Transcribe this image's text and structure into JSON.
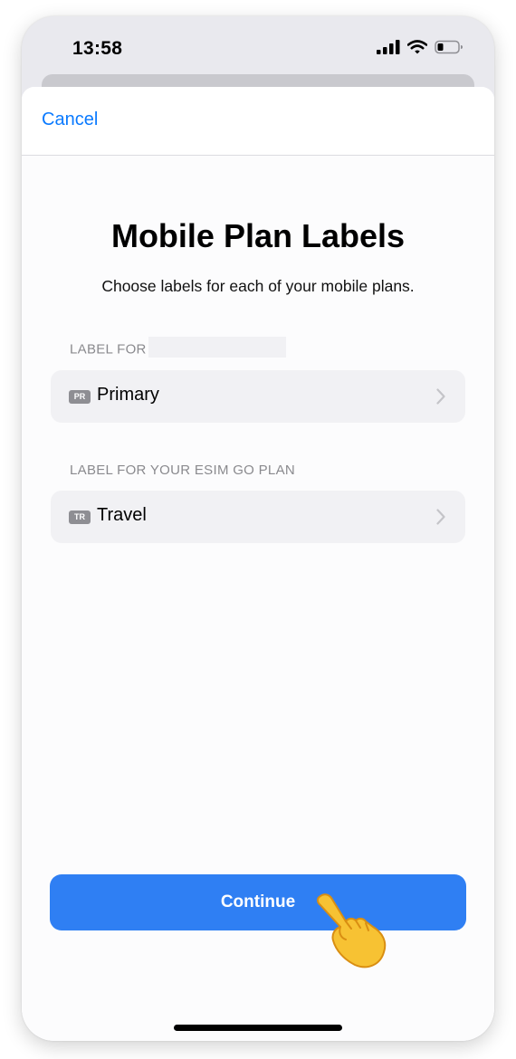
{
  "status_bar": {
    "time": "13:58",
    "icons": [
      "cellular-signal-icon",
      "wifi-icon",
      "battery-icon"
    ]
  },
  "nav": {
    "cancel_label": "Cancel"
  },
  "main": {
    "title": "Mobile Plan Labels",
    "subtitle": "Choose labels for each of your mobile plans.",
    "sections": [
      {
        "header": "LABEL FOR",
        "badge": "PR",
        "value": "Primary"
      },
      {
        "header": "LABEL FOR YOUR ESIM GO PLAN",
        "badge": "TR",
        "value": "Travel"
      }
    ]
  },
  "footer": {
    "continue_label": "Continue"
  },
  "colors": {
    "accent": "#0a7aff",
    "button": "#2f7ff3",
    "cell_background": "#f1f1f4",
    "secondary_text": "#8a8a8e"
  }
}
